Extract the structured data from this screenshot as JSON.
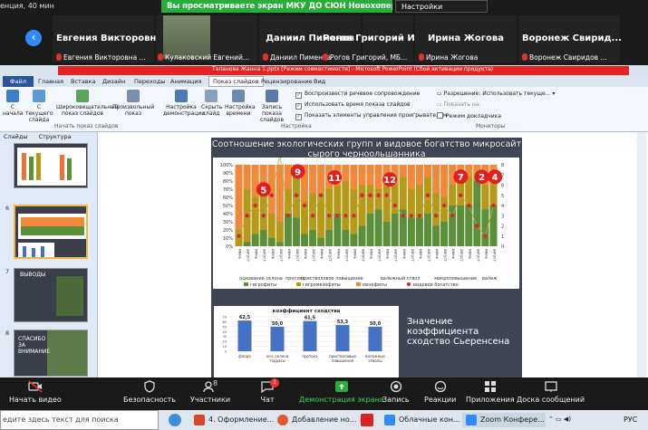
{
  "zoom": {
    "meeting_time": "енция, 40 мин",
    "share_banner": "Вы просматриваете экран МКУ ДО СЮН Новохоперского райо...",
    "view_options": "Настройки просмотра",
    "participants": [
      {
        "name": "Евгения Викторовна...",
        "sub": "Евгения Викторовна ..."
      },
      {
        "name": "",
        "sub": "Кулаковский Евгений..."
      },
      {
        "name": "Даниил Пименов",
        "sub": "Даниил Пименов"
      },
      {
        "name": "Рогов Григорий Ин...",
        "sub": "Рогов Григорий, МБ..."
      },
      {
        "name": "Ирина Жогова",
        "sub": "Ирина Жогова"
      },
      {
        "name": "Воронеж Свирид...",
        "sub": "Воронеж Свиридов ..."
      }
    ],
    "toolbar": [
      {
        "label": "Начать видео",
        "icon": "video-off-icon"
      },
      {
        "label": "Безопасность",
        "icon": "shield-icon"
      },
      {
        "label": "Участники",
        "icon": "participants-icon",
        "badge": "8"
      },
      {
        "label": "Чат",
        "icon": "chat-icon",
        "badge": "1"
      },
      {
        "label": "Демонстрация экрана",
        "icon": "share-screen-icon"
      },
      {
        "label": "Запись",
        "icon": "record-icon"
      },
      {
        "label": "Реакции",
        "icon": "reactions-icon"
      },
      {
        "label": "Приложения",
        "icon": "apps-icon"
      },
      {
        "label": "Доска сообщений",
        "icon": "whiteboard-icon"
      }
    ]
  },
  "powerpoint": {
    "title": "Таланова Жанна 1.pptx [Режим совместимости] - Microsoft PowerPoint (Сбой активации продукта)",
    "tabs": [
      "Файл",
      "Главная",
      "Вставка",
      "Дизайн",
      "Переходы",
      "Анимация",
      "Показ слайдов",
      "Рецензирование",
      "Вид"
    ],
    "active_tab": "Показ слайдов",
    "ribbon": {
      "buttons": [
        "С начала",
        "С текущего слайда",
        "Широковещательный показ слайдов",
        "Произвольный показ",
        "Настройка демонстрации",
        "Скрыть слайд",
        "Настройка времени",
        "Запись показа слайдов"
      ],
      "group1": "Начать показ слайдов",
      "group2": "Настройка",
      "group3": "Мониторы",
      "checks": [
        "Воспроизвести речевое сопровождение",
        "Использовать время показа слайдов",
        "Показать элементы управления проигрывателем"
      ],
      "resolution_label": "Разрешение:",
      "resolution_value": "Использовать текуще...",
      "show_on_label": "Показать на:",
      "presenter_mode": "Режим докладчика"
    },
    "left_tabs": [
      "Слайды",
      "Структура"
    ],
    "slide_numbers": [
      "6",
      "7",
      "8"
    ],
    "thumb_text": [
      "ВЫВОДЫ",
      "СПАСИБО ЗА ВНИМАНИЕ"
    ]
  },
  "slide": {
    "title": "Соотношение экологических групп и видовое богатство микросайт сырого черноольшанника",
    "side_text": "Значение коэффициента сходство Сьеренсена"
  },
  "chart_data": [
    {
      "type": "bar",
      "stacked": true,
      "title": "",
      "categories": [
        "июнь",
        "август",
        "июнь",
        "август",
        "июнь",
        "август",
        "июнь",
        "август",
        "июнь",
        "август",
        "июнь",
        "август",
        "июнь",
        "август",
        "июнь",
        "август",
        "июнь",
        "август",
        "июнь",
        "август",
        "июнь",
        "август",
        "июнь",
        "август",
        "июнь",
        "август",
        "июнь",
        "август",
        "июнь",
        "август",
        "июнь",
        "август"
      ],
      "group_labels": [
        "основание склона",
        "протока",
        "пристволовое повышение",
        "валежный ствол",
        "микроповышение",
        "валеж"
      ],
      "series": [
        {
          "name": "гигрофиты",
          "color": "#5b8f3a",
          "values": [
            0,
            5,
            15,
            20,
            10,
            5,
            40,
            35,
            15,
            20,
            10,
            20,
            40,
            20,
            15,
            25,
            40,
            45,
            30,
            40,
            45,
            35,
            35,
            40,
            25,
            30,
            50,
            50,
            50,
            80,
            45,
            50
          ]
        },
        {
          "name": "гигромезофиты",
          "color": "#b59a1a",
          "values": [
            20,
            65,
            45,
            55,
            30,
            25,
            30,
            50,
            40,
            45,
            55,
            50,
            35,
            60,
            55,
            50,
            35,
            25,
            45,
            35,
            40,
            35,
            40,
            45,
            40,
            30,
            25,
            30,
            35,
            10,
            30,
            30
          ]
        },
        {
          "name": "мезофиты",
          "color": "#ef8a3c",
          "values": [
            80,
            30,
            40,
            25,
            60,
            70,
            30,
            15,
            45,
            35,
            35,
            30,
            25,
            20,
            30,
            25,
            25,
            30,
            25,
            25,
            15,
            30,
            25,
            15,
            35,
            40,
            25,
            20,
            15,
            10,
            25,
            20
          ]
        },
        {
          "name": "видовое богатство",
          "type": "line",
          "color": "#d7262c",
          "values": [
            1,
            3,
            4,
            3,
            5,
            9,
            3,
            5,
            4,
            3,
            5,
            3,
            3,
            3,
            3,
            5,
            5,
            5,
            5,
            4,
            3,
            3,
            3,
            5,
            3,
            4,
            3,
            5,
            4,
            2,
            1,
            4
          ]
        }
      ],
      "ylim": [
        0,
        100
      ],
      "y_ticks": [
        "0%",
        "10%",
        "20%",
        "30%",
        "40%",
        "50%",
        "60%",
        "70%",
        "80%",
        "90%",
        "100%"
      ],
      "y2lim": [
        0,
        8
      ],
      "y2_ticks": [
        "0",
        "1",
        "2",
        "3",
        "4",
        "5",
        "6",
        "7",
        "8"
      ],
      "annotations": [
        "5",
        "9",
        "11",
        "12",
        "7",
        "2",
        "4"
      ],
      "legend_position": "bottom"
    },
    {
      "type": "bar",
      "title": "коэффициент сходства",
      "categories": [
        "флора",
        "осн. склона террасы",
        "протока",
        "пристволовые повышения",
        "валежные стволы"
      ],
      "values": [
        62.5,
        50.0,
        61.5,
        53.3,
        50.0
      ],
      "value_labels": [
        "62,5",
        "50,0",
        "61,5",
        "53,3",
        "50,0"
      ],
      "ylim": [
        0,
        70
      ],
      "y_ticks": [
        "0",
        "10",
        "20",
        "30",
        "40",
        "50",
        "60",
        "70"
      ],
      "color": "#4472c4"
    }
  ],
  "taskbar": {
    "search_placeholder": "едите здесь текст для поиска",
    "items": [
      "4. Оформление...",
      "Добавление но...",
      "Облачные кон...",
      "Zoom Конфере..."
    ],
    "lang": "РУС",
    "time": "",
    "date": ""
  }
}
